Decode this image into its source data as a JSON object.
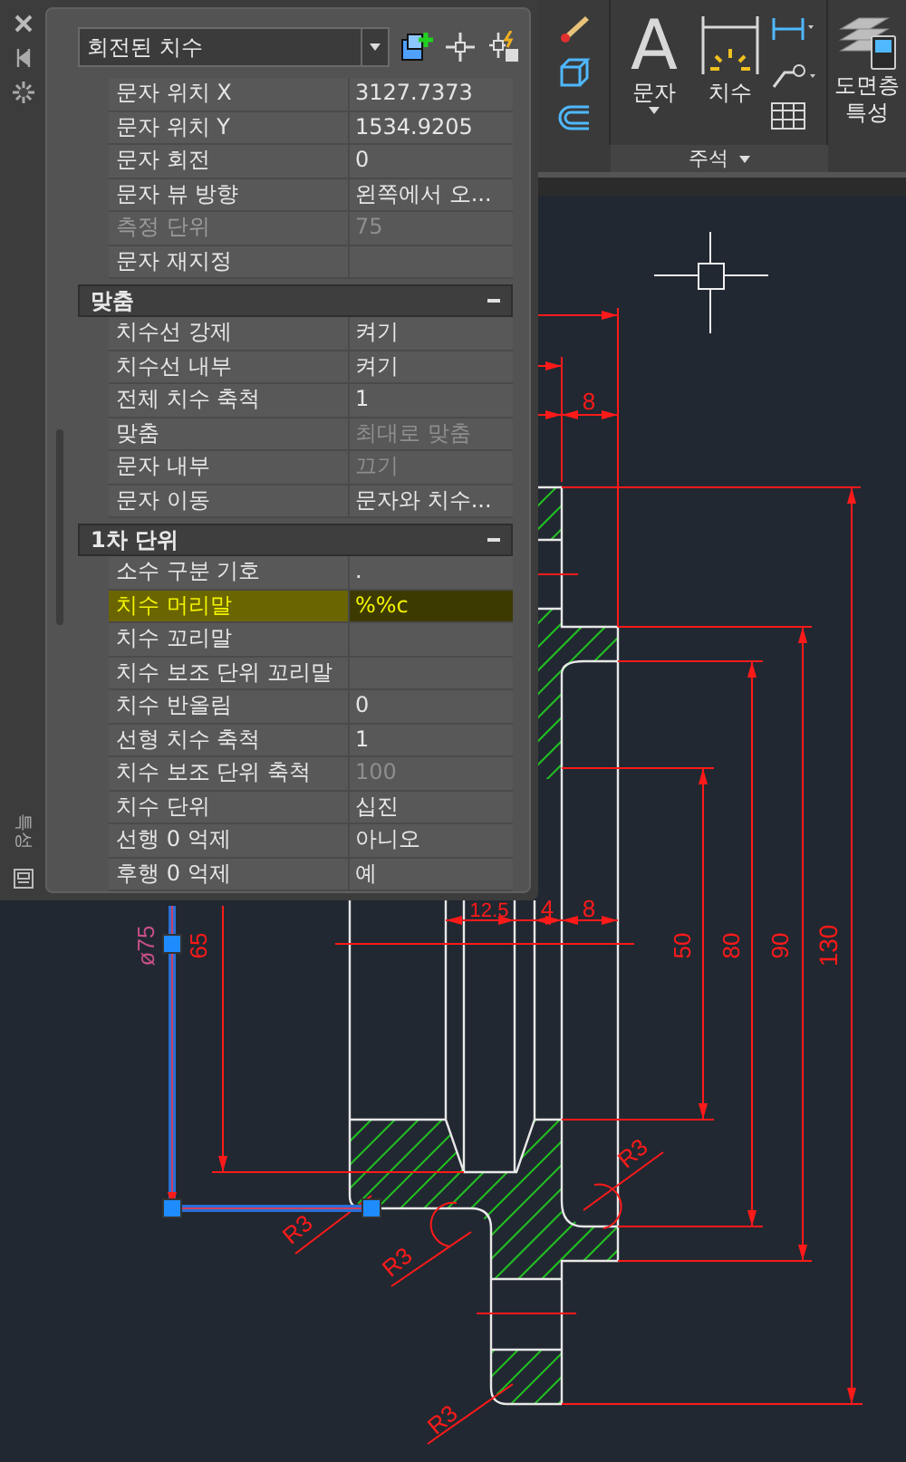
{
  "properties_panel": {
    "tab_label": "특성",
    "object_type": "회전된 치수",
    "sections": [
      {
        "rows": [
          {
            "label": "문자 위치 X",
            "value": "3127.7373",
            "selected": false,
            "label_disabled": false,
            "value_disabled": false
          },
          {
            "label": "문자 위치 Y",
            "value": "1534.9205",
            "selected": false,
            "label_disabled": false,
            "value_disabled": false
          },
          {
            "label": "문자 회전",
            "value": "0",
            "selected": false,
            "label_disabled": false,
            "value_disabled": false
          },
          {
            "label": "문자 뷰 방향",
            "value": "왼쪽에서 오...",
            "selected": false,
            "label_disabled": false,
            "value_disabled": false
          },
          {
            "label": "측정 단위",
            "value": "75",
            "selected": false,
            "label_disabled": true,
            "value_disabled": true
          },
          {
            "label": "문자 재지정",
            "selected": false,
            "label_disabled": false,
            "value_disabled": false
          }
        ]
      },
      {
        "title": "맞춤",
        "expanded": true,
        "rows": [
          {
            "label": "치수선 강제",
            "value": "켜기",
            "selected": false,
            "label_disabled": false,
            "value_disabled": false
          },
          {
            "label": "치수선 내부",
            "value": "켜기",
            "selected": false,
            "label_disabled": false,
            "value_disabled": false
          },
          {
            "label": "전체 치수 축척",
            "value": "1",
            "selected": false,
            "label_disabled": false,
            "value_disabled": false
          },
          {
            "label": "맞춤",
            "value": "최대로 맞춤",
            "selected": false,
            "label_disabled": false,
            "value_disabled": true
          },
          {
            "label": "문자 내부",
            "value": "끄기",
            "selected": false,
            "label_disabled": false,
            "value_disabled": true
          },
          {
            "label": "문자 이동",
            "value": "문자와 치수...",
            "selected": false,
            "label_disabled": false,
            "value_disabled": false
          }
        ]
      },
      {
        "title": "1차 단위",
        "expanded": true,
        "rows": [
          {
            "label": "소수 구분 기호",
            "value": ".",
            "selected": false,
            "label_disabled": false,
            "value_disabled": false
          },
          {
            "label": "치수 머리말",
            "value": "%%c",
            "selected": true,
            "label_disabled": false,
            "value_disabled": false
          },
          {
            "label": "치수 꼬리말",
            "selected": false,
            "label_disabled": false,
            "value_disabled": false
          },
          {
            "label": "치수 보조 단위 꼬리말",
            "selected": false,
            "label_disabled": false,
            "value_disabled": false
          },
          {
            "label": "치수 반올림",
            "value": "0",
            "selected": false,
            "label_disabled": false,
            "value_disabled": false
          },
          {
            "label": "선형 치수 축척",
            "value": "1",
            "selected": false,
            "label_disabled": false,
            "value_disabled": false
          },
          {
            "label": "치수 보조 단위 축척",
            "value": "100",
            "selected": false,
            "label_disabled": false,
            "value_disabled": true
          },
          {
            "label": "치수 단위",
            "value": "십진",
            "selected": false,
            "label_disabled": false,
            "value_disabled": false
          },
          {
            "label": "선행 0 억제",
            "value": "아니오",
            "selected": false,
            "label_disabled": false,
            "value_disabled": false
          },
          {
            "label": "후행 0 억제",
            "value": "예",
            "selected": false,
            "label_disabled": false,
            "value_disabled": false
          }
        ]
      }
    ]
  },
  "ribbon": {
    "tools": [
      {
        "kind": "text",
        "icon_text": "A",
        "label": "문자",
        "has_menu": true
      },
      {
        "kind": "dimension",
        "label": "치수",
        "has_menu": false
      }
    ],
    "panel_label": "주석",
    "layer_properties": {
      "lines": [
        "도면층",
        "특성"
      ]
    }
  },
  "drawing": {
    "dimension_labels": [
      {
        "text": "8",
        "selected": false
      },
      {
        "text": "12.5",
        "selected": false
      },
      {
        "text": "4",
        "selected": false
      },
      {
        "text": "8",
        "selected": false
      },
      {
        "text": "ø75",
        "selected": true
      },
      {
        "text": "65",
        "selected": false
      },
      {
        "text": "50",
        "selected": false
      },
      {
        "text": "80",
        "selected": false
      },
      {
        "text": "90",
        "selected": false
      },
      {
        "text": "130",
        "selected": false
      },
      {
        "text": "R3",
        "selected": false
      },
      {
        "text": "R3",
        "selected": false
      },
      {
        "text": "R3",
        "selected": false
      },
      {
        "text": "R3",
        "selected": false
      }
    ]
  }
}
